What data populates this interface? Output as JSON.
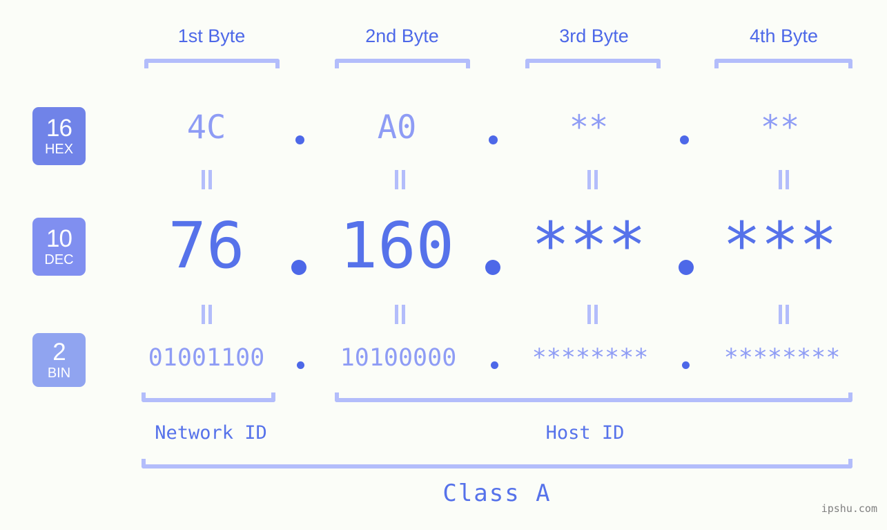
{
  "meta": {
    "background_color": "#fbfdf8",
    "accent_color": "#4d68e8",
    "light_accent_color": "#b3bdfb",
    "mid_accent_color": "#8e9cf5"
  },
  "headers": [
    {
      "label": "1st Byte"
    },
    {
      "label": "2nd Byte"
    },
    {
      "label": "3rd Byte"
    },
    {
      "label": "4th Byte"
    }
  ],
  "bases": [
    {
      "number": "16",
      "name": "HEX",
      "color": "#7083e8"
    },
    {
      "number": "10",
      "name": "DEC",
      "color": "#808ff0"
    },
    {
      "number": "2",
      "name": "BIN",
      "color": "#90a4f0"
    }
  ],
  "rows": {
    "hex": {
      "base": "16",
      "base_name": "HEX",
      "bytes": [
        "4C",
        "A0",
        "**",
        "**"
      ],
      "separator": "."
    },
    "dec": {
      "base": "10",
      "base_name": "DEC",
      "bytes": [
        "76",
        "160",
        "***",
        "***"
      ],
      "separator": "."
    },
    "bin": {
      "base": "2",
      "base_name": "BIN",
      "bytes": [
        "01001100",
        "10100000",
        "********",
        "********"
      ],
      "separator": "."
    }
  },
  "connectors": {
    "glyph": "‖",
    "count_per_row": 4
  },
  "sections": [
    {
      "label": "Network ID"
    },
    {
      "label": "Host ID"
    }
  ],
  "class": {
    "label": "Class A"
  },
  "watermark": {
    "text": "ipshu.com"
  }
}
